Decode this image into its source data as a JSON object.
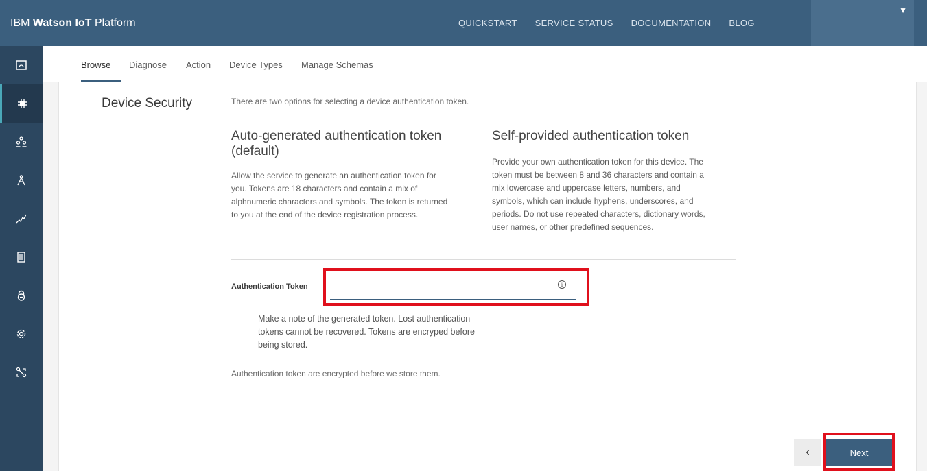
{
  "brand": {
    "prefix": "IBM ",
    "strong": "Watson IoT",
    "suffix": " Platform"
  },
  "top_nav": [
    {
      "label": "QUICKSTART"
    },
    {
      "label": "SERVICE STATUS"
    },
    {
      "label": "DOCUMENTATION"
    },
    {
      "label": "BLOG"
    }
  ],
  "user_menu": {
    "caret": "▼"
  },
  "rail_icons": [
    "dashboard-icon",
    "devices-icon",
    "members-icon",
    "apps-icon",
    "analytics-icon",
    "documents-icon",
    "security-icon",
    "settings-icon",
    "extensions-icon"
  ],
  "tabs": [
    {
      "label": "Browse",
      "active": true
    },
    {
      "label": "Diagnose"
    },
    {
      "label": "Action"
    },
    {
      "label": "Device Types"
    },
    {
      "label": "Manage Schemas"
    }
  ],
  "section": {
    "title": "Device Security",
    "intro": "There are two options for selecting a device authentication token."
  },
  "options": {
    "auto": {
      "heading_line1": "Auto-generated authentication token",
      "heading_line2": "(default)",
      "body": [
        "Allow the service to generate an authentication token for",
        "you. Tokens are 18 characters and contain a mix of",
        "alphnumeric characters and symbols. The token is returned",
        "to you at the end of the device registration process."
      ]
    },
    "self": {
      "heading": "Self-provided authentication token",
      "body": [
        "Provide your own authentication token for this device. The",
        "token must be between 8 and 36 characters and contain a",
        "mix lowercase and uppercase letters, numbers, and",
        "symbols, which can include hyphens, underscores, and",
        "periods. Do not use repeated characters, dictionary words,",
        "user names, or other predefined sequences."
      ]
    }
  },
  "token": {
    "label": "Authentication Token",
    "value": "",
    "placeholder": "",
    "info_glyph": "i"
  },
  "note": "Make a note of the generated token. Lost authentication tokens cannot be recovered. Tokens are encryped before being stored.",
  "footer_note": "Authentication token are encrypted before we store them.",
  "buttons": {
    "back": "‹",
    "next": "Next"
  },
  "colors": {
    "header": "#3b5f7e",
    "rail": "#2c4760",
    "highlight": "#e0101c"
  }
}
